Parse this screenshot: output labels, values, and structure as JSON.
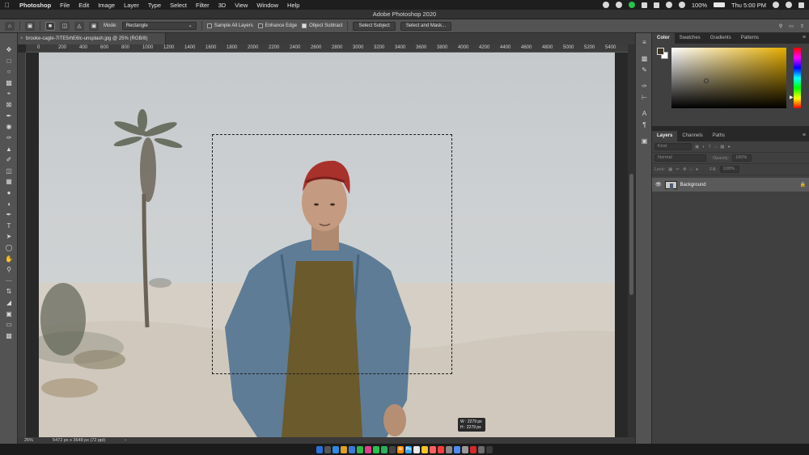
{
  "menubar": {
    "app": "Photoshop",
    "items": [
      "File",
      "Edit",
      "Image",
      "Layer",
      "Type",
      "Select",
      "Filter",
      "3D",
      "View",
      "Window",
      "Help"
    ],
    "battery": "100%",
    "clock": "Thu 5:00 PM"
  },
  "window": {
    "title": "Adobe Photoshop 2020"
  },
  "options": {
    "mode_label": "Mode:",
    "mode_value": "Rectangle",
    "sample_all_layers": "Sample All Layers",
    "enhance_edge": "Enhance Edge",
    "object_subtract": "Object Subtract",
    "select_subject": "Select Subject",
    "select_and_mask": "Select and Mask..."
  },
  "document": {
    "tab_title": "brooke-cagle-7ITE5rhE6lc-unsplash.jpg @ 25% (RGB/8)",
    "close": "×"
  },
  "ruler": {
    "ticks": [
      "0",
      "200",
      "400",
      "600",
      "800",
      "1000",
      "1200",
      "1400",
      "1600",
      "1800",
      "2000",
      "2200",
      "2400",
      "2600",
      "2800",
      "3000",
      "3200",
      "3400",
      "3600",
      "3800",
      "4000",
      "4200",
      "4400",
      "4600",
      "4800",
      "5000",
      "5200",
      "5400"
    ]
  },
  "selection_readout": {
    "w": "W : 2279 px",
    "h": "H : 2279 px"
  },
  "status": {
    "zoom": "25%",
    "doc_size": "5472 px x 3648 px (72 ppi)",
    "arrow": "›"
  },
  "color_panel": {
    "tabs": [
      "Color",
      "Swatches",
      "Gradients",
      "Patterns"
    ],
    "active": "Color"
  },
  "layers_panel": {
    "tabs": [
      "Layers",
      "Channels",
      "Paths"
    ],
    "active": "Layers",
    "kind": "Kind",
    "blend_mode": "Normal",
    "opacity_label": "Opacity:",
    "opacity_value": "100%",
    "lock_label": "Lock:",
    "fill_label": "Fill:",
    "fill_value": "100%",
    "layers": [
      {
        "name": "Background",
        "visible": true,
        "locked": true
      }
    ]
  },
  "colors": {
    "accent": "#e5ad00",
    "panel_bg": "#404040",
    "tool_bg": "#535353"
  }
}
